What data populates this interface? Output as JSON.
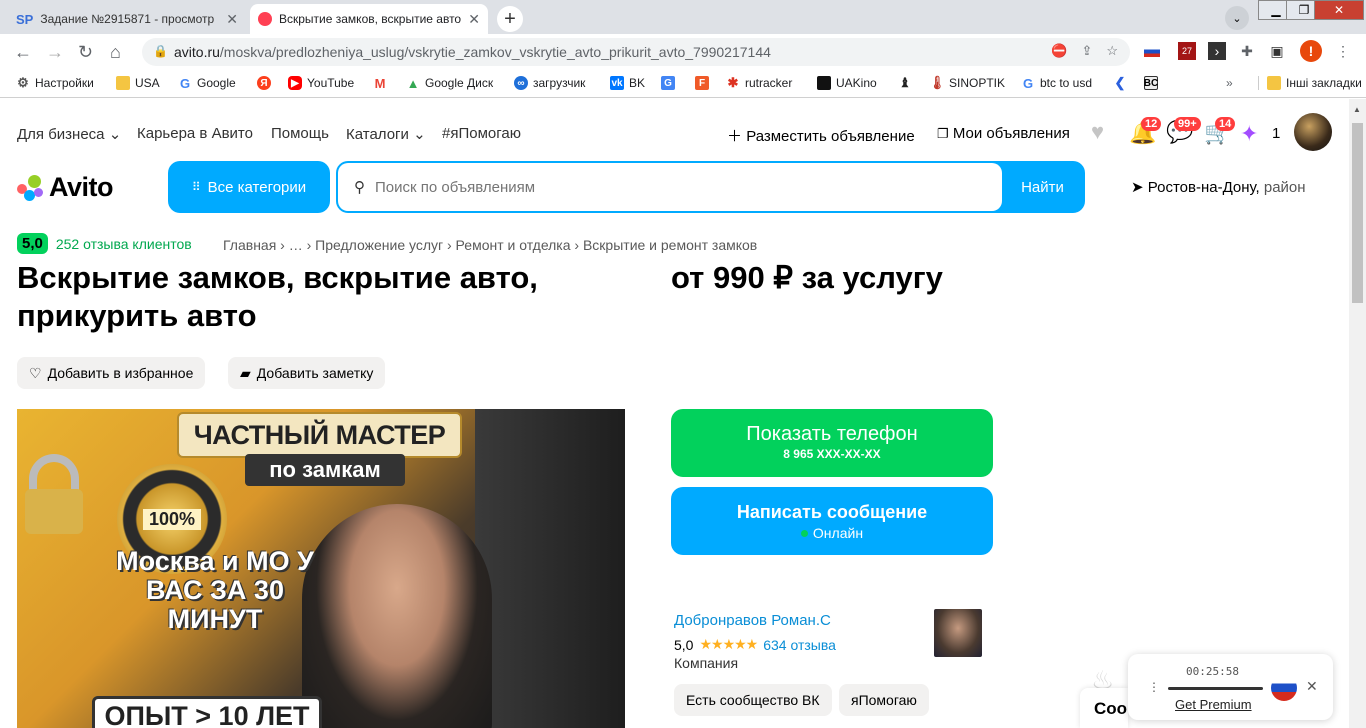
{
  "browser": {
    "tabs": [
      {
        "icon": "SP",
        "title": "Задание №2915871 - просмотр"
      },
      {
        "icon": "avito-favicon",
        "title": "Вскрытие замков, вскрытие авто"
      }
    ],
    "url_domain": "avito.ru",
    "url_path": "/moskva/predlozheniya_uslug/vskrytie_zamkov_vskrytie_avto_prikurit_avto_7990217144",
    "ext_badge": "27",
    "profile_letter": "!"
  },
  "bookmarks": [
    "Настройки",
    "USA",
    "Google",
    "",
    "YouTube",
    "",
    "Google Диск",
    "загрузчик",
    "BK",
    "",
    "",
    "rutracker",
    "UAKino",
    "",
    "SINOPTIK",
    "btc to usd",
    "",
    ""
  ],
  "bookmarks_other": "Інші закладки",
  "site": {
    "nav": {
      "business": "Для бизнеса",
      "career": "Карьера в Авито",
      "help": "Помощь",
      "catalogs": "Каталоги",
      "yapomogayu": "#яПомогаю",
      "post": "Разместить объявление",
      "my_ads": "Мои объявления",
      "notif_badge": "12",
      "msg_badge": "99+",
      "cart_badge": "14",
      "bonus_count": "1"
    },
    "logo": "Avito",
    "categories": "Все категории",
    "search": {
      "placeholder": "Поиск по объявлениям",
      "button": "Найти"
    },
    "city": "Ростов-на-Дону,",
    "city_area": "район"
  },
  "listing": {
    "rating_score": "5,0",
    "reviews": "252 отзыва клиентов",
    "breadcrumbs": "Главная › … › Предложение услуг › Ремонт и отделка › Вскрытие и ремонт замков",
    "title": "Вскрытие замков, вскрытие авто, прикурить авто",
    "price": "от 990 ₽ за услугу",
    "favorite": "Добавить в избранное",
    "note": "Добавить заметку",
    "photo": {
      "banner": "ЧАСТНЫЙ МАСТЕР",
      "sub": "по замкам",
      "seal": "100%",
      "city_line": "Москва и МО У ВАС ЗА 30 МИНУТ",
      "experience": "ОПЫТ > 10 ЛЕТ"
    },
    "call_button": "Показать телефон",
    "phone_masked": "8 965 XXX-XX-XX",
    "message_button": "Написать сообщение",
    "online": "Онлайн",
    "seller": {
      "name": "Добронравов Роман.С",
      "score": "5,0",
      "stars": "★★★★★",
      "reviews": "634 отзыва",
      "type": "Компания"
    },
    "tags": [
      "Есть сообщество ВК",
      "яПомогаю"
    ]
  },
  "widget": {
    "time": "00:25:58",
    "premium": "Get Premium"
  },
  "chat_stub": "Соо"
}
